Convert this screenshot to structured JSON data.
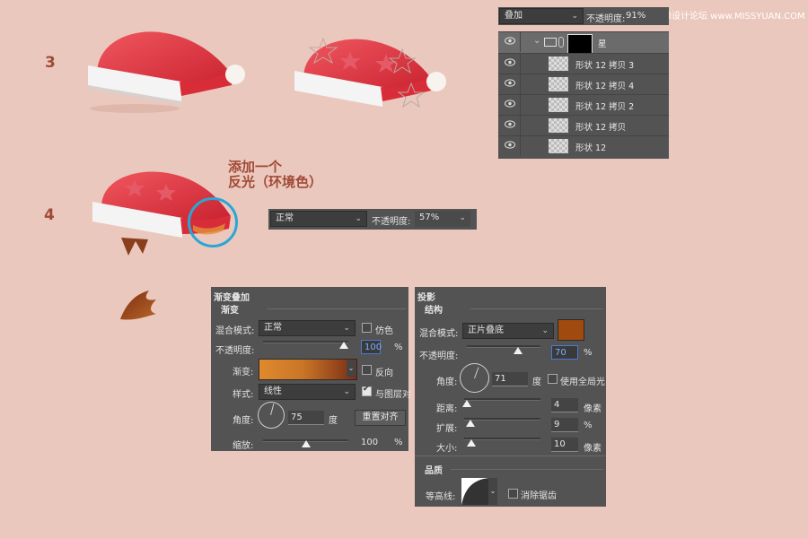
{
  "watermark": "思缘设计论坛 www.MISSYUAN.COM",
  "colors": {
    "background": "#ebc8bd",
    "accent": "#a04a36",
    "highlight_ring": "#2aa6d6",
    "shadow_color": "#a04a10"
  },
  "steps": {
    "three": "3",
    "four": "4"
  },
  "callout": {
    "line1": "添加一个",
    "line2": "反光（环境色）"
  },
  "layers_panel": {
    "blend_mode": "叠加",
    "opacity_label": "不透明度:",
    "opacity_value": "91%",
    "group_name": "星",
    "layers": [
      {
        "name": "形状 12 拷贝 3"
      },
      {
        "name": "形状 12 拷贝 4"
      },
      {
        "name": "形状 12 拷贝 2"
      },
      {
        "name": "形状 12 拷贝"
      },
      {
        "name": "形状 12"
      }
    ]
  },
  "mini_bar": {
    "blend_mode": "正常",
    "opacity_label": "不透明度:",
    "opacity_value": "57%"
  },
  "gradient_overlay": {
    "title": "渐变叠加",
    "section": "渐变",
    "blend_mode_label": "混合模式:",
    "blend_mode": "正常",
    "dither_label": "仿色",
    "opacity_label": "不透明度:",
    "opacity_value": "100",
    "opacity_unit": "%",
    "opacity_level": 0.95,
    "gradient_label": "渐变:",
    "reverse_label": "反向",
    "style_label": "样式:",
    "style": "线性",
    "align_label": "与图层对",
    "angle_label": "角度:",
    "angle_value": "75",
    "angle_unit": "度",
    "reset_button": "重置对齐",
    "scale_label": "缩放:",
    "scale_value": "100",
    "scale_unit": "%",
    "scale_level": 0.5
  },
  "drop_shadow": {
    "title": "投影",
    "section": "结构",
    "blend_mode_label": "混合模式:",
    "blend_mode": "正片叠底",
    "opacity_label": "不透明度:",
    "opacity_value": "70",
    "opacity_unit": "%",
    "opacity_level": 0.7,
    "angle_label": "角度:",
    "angle_value": "71",
    "angle_unit": "度",
    "global_light_label": "使用全局光",
    "distance_label": "距离:",
    "distance_value": "4",
    "distance_unit": "像素",
    "spread_label": "扩展:",
    "spread_value": "9",
    "spread_unit": "%",
    "size_label": "大小:",
    "size_value": "10",
    "size_unit": "像素",
    "quality_title": "品质",
    "contour_label": "等高线:",
    "antialias_label": "消除锯齿"
  }
}
